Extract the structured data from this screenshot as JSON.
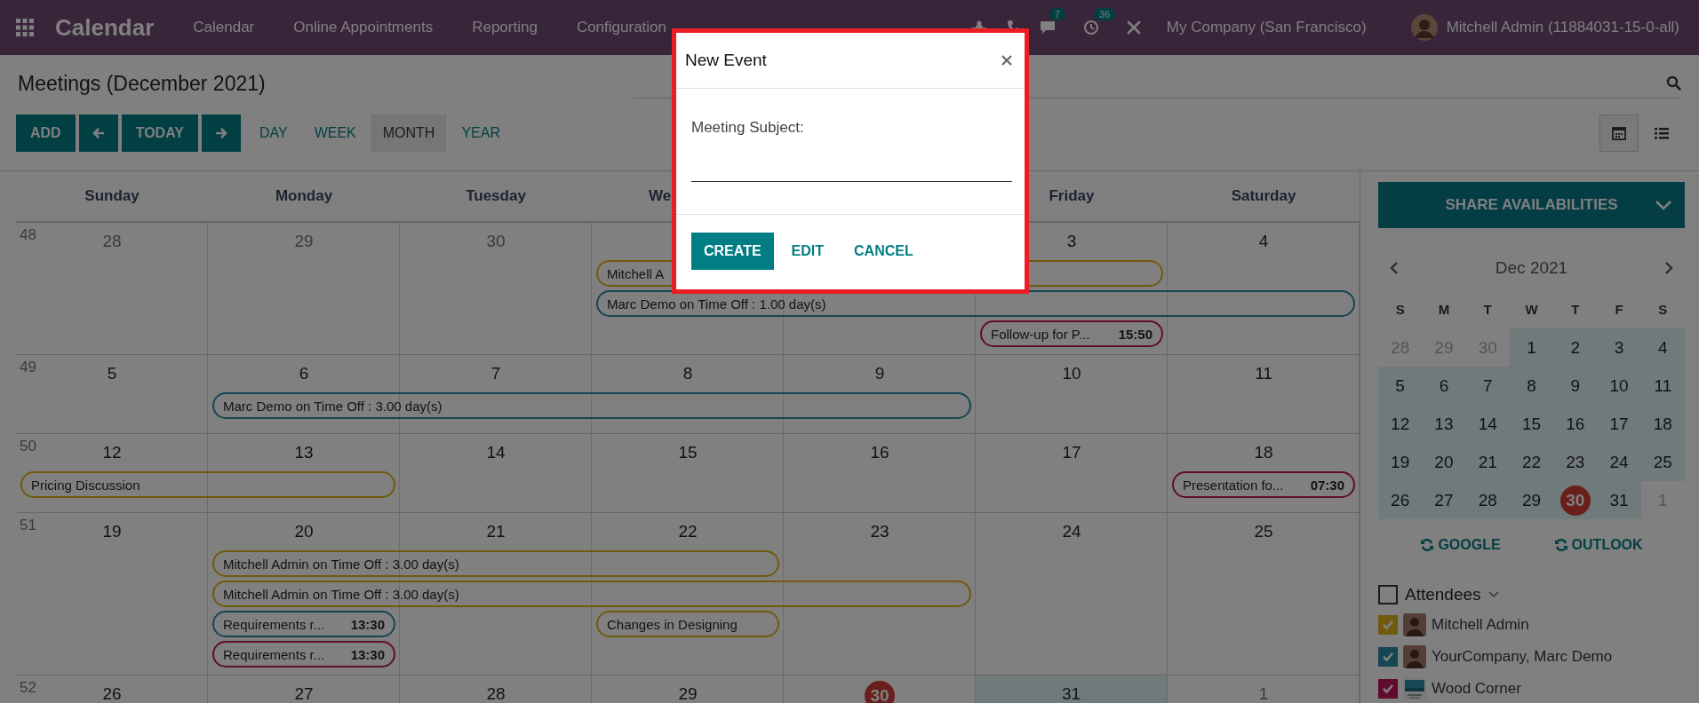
{
  "app": {
    "name": "Calendar",
    "menu": [
      "Calendar",
      "Online Appointments",
      "Reporting",
      "Configuration"
    ],
    "systray": {
      "messages_badge": "7",
      "activities_badge": "36",
      "company": "My Company (San Francisco)",
      "user": "Mitchell Admin (11884031-15-0-all)"
    }
  },
  "page": {
    "title": "Meetings (December 2021)"
  },
  "toolbar": {
    "add": "ADD",
    "today": "TODAY",
    "scales": [
      {
        "label": "DAY",
        "selected": false
      },
      {
        "label": "WEEK",
        "selected": false
      },
      {
        "label": "MONTH",
        "selected": true
      },
      {
        "label": "YEAR",
        "selected": false
      }
    ],
    "views": [
      {
        "kind": "calendar",
        "selected": true
      },
      {
        "kind": "list",
        "selected": false
      }
    ]
  },
  "calendar": {
    "weekdays": [
      "Sunday",
      "Monday",
      "Tuesday",
      "We",
      "Friday",
      "Saturday"
    ],
    "weeks": [
      {
        "number": "48",
        "days": [
          {
            "label": "28",
            "kind": "muted"
          },
          {
            "label": "29",
            "kind": "muted"
          },
          {
            "label": "30",
            "kind": "muted"
          },
          {
            "kind": "day"
          },
          {
            "kind": "day"
          },
          {
            "label": "3",
            "kind": "day"
          },
          {
            "label": "4",
            "kind": "day"
          }
        ],
        "events": [
          {
            "title": "Mitchell A",
            "color": "#705a0e"
          },
          {
            "title": "Marc Demo on Time Off : 1.00 day(s)",
            "color": "#154653"
          },
          {
            "title": "Follow-up for P...",
            "time": "15:50",
            "color": "#610c2e"
          }
        ]
      },
      {
        "number": "49",
        "days": [
          {
            "label": "5",
            "kind": "day"
          },
          {
            "label": "6",
            "kind": "day"
          },
          {
            "label": "7",
            "kind": "day"
          },
          {
            "label": "8",
            "kind": "day"
          },
          {
            "label": "9",
            "kind": "day"
          },
          {
            "label": "10",
            "kind": "day"
          },
          {
            "label": "11",
            "kind": "day"
          }
        ],
        "events": [
          {
            "title": "Marc Demo on Time Off : 3.00 day(s)",
            "color": "#154653"
          }
        ]
      },
      {
        "number": "50",
        "days": [
          {
            "label": "12",
            "kind": "day"
          },
          {
            "label": "13",
            "kind": "day"
          },
          {
            "label": "14",
            "kind": "day"
          },
          {
            "label": "15",
            "kind": "day"
          },
          {
            "label": "16",
            "kind": "day"
          },
          {
            "label": "17",
            "kind": "day"
          },
          {
            "label": "18",
            "kind": "day"
          }
        ],
        "events": [
          {
            "title": "Pricing Discussion",
            "color": "#705a0e"
          },
          {
            "title": "Presentation fo...",
            "time": "07:30",
            "color": "#610c2e"
          }
        ]
      },
      {
        "number": "51",
        "days": [
          {
            "label": "19",
            "kind": "day"
          },
          {
            "label": "20",
            "kind": "day"
          },
          {
            "label": "21",
            "kind": "day"
          },
          {
            "label": "22",
            "kind": "day"
          },
          {
            "label": "23",
            "kind": "day"
          },
          {
            "label": "24",
            "kind": "day"
          },
          {
            "label": "25",
            "kind": "day"
          }
        ],
        "events": [
          {
            "title": "Mitchell Admin on Time Off : 3.00 day(s)",
            "color": "#705a0e"
          },
          {
            "title": "Mitchell Admin on Time Off : 3.00 day(s)",
            "color": "#705a0e"
          },
          {
            "title": "Requirements r...",
            "time": "13:30",
            "color": "#154653"
          },
          {
            "title": "Changes in Designing",
            "color": "#705a0e"
          },
          {
            "title": "Requirements r...",
            "time": "13:30",
            "color": "#610c2e"
          }
        ]
      },
      {
        "number": "52",
        "days": [
          {
            "label": "26",
            "kind": "day"
          },
          {
            "label": "27",
            "kind": "day"
          },
          {
            "label": "28",
            "kind": "day"
          },
          {
            "label": "29",
            "kind": "day"
          },
          {
            "label": "30",
            "kind": "today"
          },
          {
            "label": "31",
            "kind": "focus"
          },
          {
            "label": "1",
            "kind": "muted"
          }
        ]
      }
    ]
  },
  "sidebar": {
    "share": "SHARE AVAILABILITIES",
    "month": "Dec 2021",
    "weekdays": [
      "S",
      "M",
      "T",
      "W",
      "T",
      "F",
      "S"
    ],
    "weeks": [
      [
        {
          "label": "28",
          "kind": "out"
        },
        {
          "label": "29",
          "kind": "out"
        },
        {
          "label": "30",
          "kind": "out"
        },
        {
          "label": "1",
          "kind": "in"
        },
        {
          "label": "2",
          "kind": "in"
        },
        {
          "label": "3",
          "kind": "in"
        },
        {
          "label": "4",
          "kind": "in"
        }
      ],
      [
        {
          "label": "5",
          "kind": "in"
        },
        {
          "label": "6",
          "kind": "in"
        },
        {
          "label": "7",
          "kind": "in"
        },
        {
          "label": "8",
          "kind": "in"
        },
        {
          "label": "9",
          "kind": "in"
        },
        {
          "label": "10",
          "kind": "in"
        },
        {
          "label": "11",
          "kind": "in"
        }
      ],
      [
        {
          "label": "12",
          "kind": "in"
        },
        {
          "label": "13",
          "kind": "in"
        },
        {
          "label": "14",
          "kind": "in"
        },
        {
          "label": "15",
          "kind": "in"
        },
        {
          "label": "16",
          "kind": "in"
        },
        {
          "label": "17",
          "kind": "in"
        },
        {
          "label": "18",
          "kind": "in"
        }
      ],
      [
        {
          "label": "19",
          "kind": "in"
        },
        {
          "label": "20",
          "kind": "in"
        },
        {
          "label": "21",
          "kind": "in"
        },
        {
          "label": "22",
          "kind": "in"
        },
        {
          "label": "23",
          "kind": "in"
        },
        {
          "label": "24",
          "kind": "in"
        },
        {
          "label": "25",
          "kind": "in"
        }
      ],
      [
        {
          "label": "26",
          "kind": "in"
        },
        {
          "label": "27",
          "kind": "in"
        },
        {
          "label": "28",
          "kind": "in"
        },
        {
          "label": "29",
          "kind": "in"
        },
        {
          "label": "30",
          "kind": "today"
        },
        {
          "label": "31",
          "kind": "in"
        },
        {
          "label": "1",
          "kind": "out"
        }
      ]
    ],
    "sync": [
      "GOOGLE",
      "OUTLOOK"
    ],
    "attendees": {
      "label": "Attendees",
      "checked": false,
      "items": [
        {
          "name": "Mitchell Admin",
          "checked": true,
          "color": "#705a0e",
          "kind": "person"
        },
        {
          "name": "YourCompany, Marc Demo",
          "checked": true,
          "color": "#154653",
          "kind": "person"
        },
        {
          "name": "Wood Corner",
          "checked": true,
          "color": "#610c2e",
          "kind": "logo"
        }
      ]
    }
  },
  "modal": {
    "title": "New Event",
    "field_label": "Meeting Subject:",
    "buttons": [
      {
        "label": "CREATE",
        "kind": "primary"
      },
      {
        "label": "EDIT",
        "kind": "link"
      },
      {
        "label": "CANCEL",
        "kind": "link"
      }
    ]
  }
}
